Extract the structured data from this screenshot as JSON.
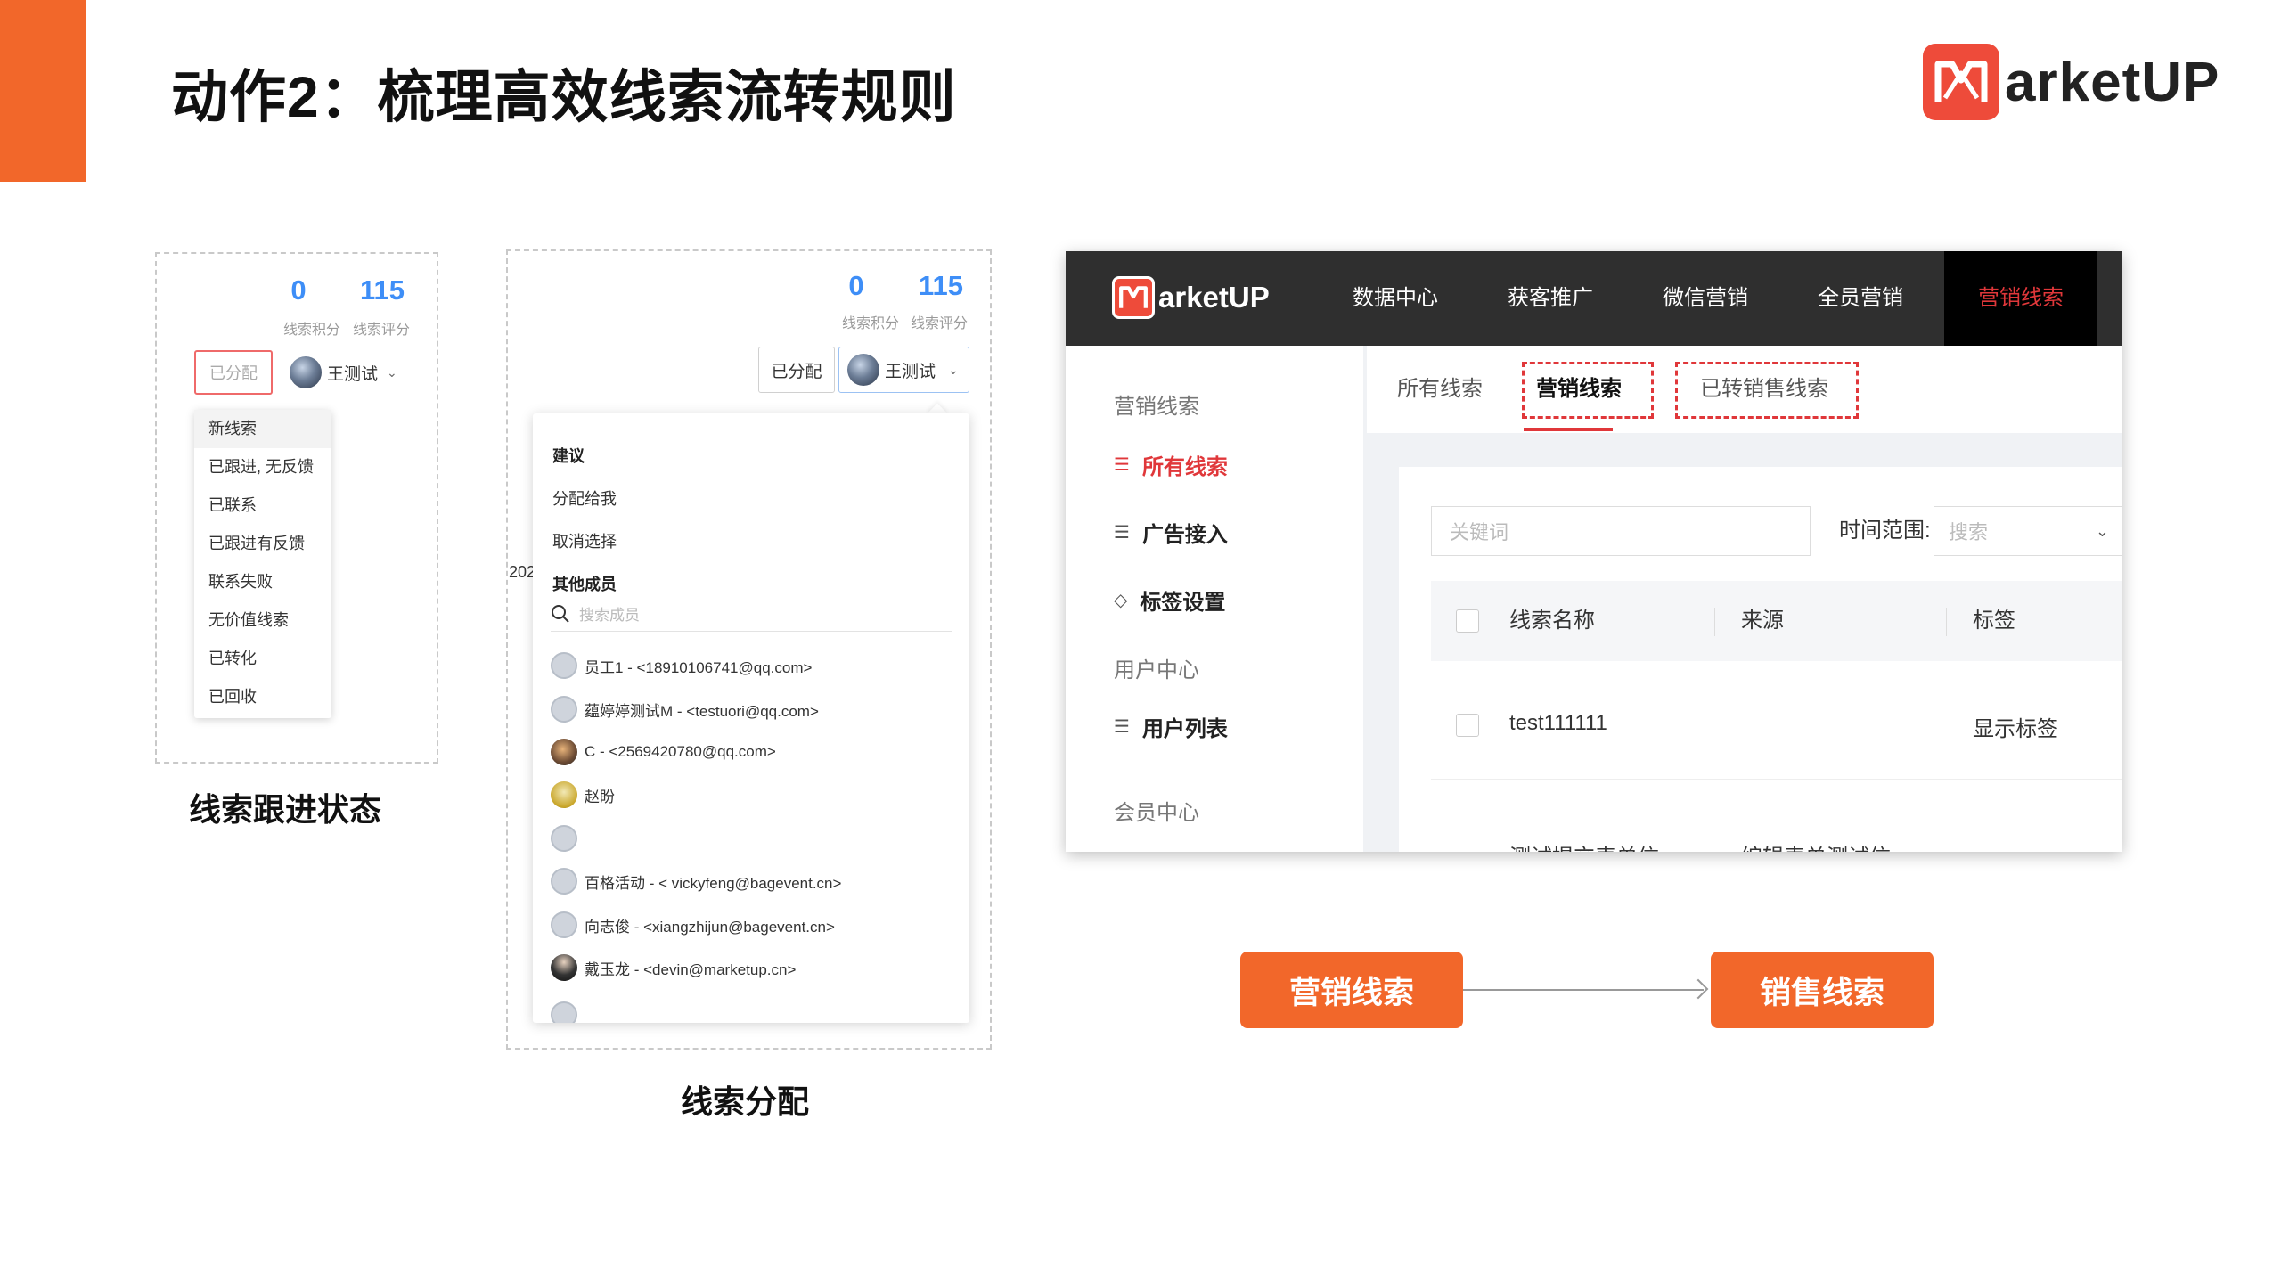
{
  "slide": {
    "title": "动作2：梳理高效线索流转规则",
    "brand_text": "arketUP",
    "accent_color": "#f2672a"
  },
  "panel_status": {
    "stats": [
      {
        "value": "0",
        "label": "线索积分"
      },
      {
        "value": "115",
        "label": "线索评分"
      }
    ],
    "assigned_button": "已分配",
    "user_name": "王测试",
    "status_menu": [
      "新线索",
      "已跟进, 无反馈",
      "已联系",
      "已跟进有反馈",
      "联系失败",
      "无价值线索",
      "已转化",
      "已回收"
    ],
    "caption": "线索跟进状态"
  },
  "panel_assign": {
    "stats": [
      {
        "value": "0",
        "label": "线索积分"
      },
      {
        "value": "115",
        "label": "线索评分"
      }
    ],
    "assigned_button": "已分配",
    "user_name": "王测试",
    "side_peek": "202",
    "suggest_header": "建议",
    "suggest_items": [
      "分配给我",
      "取消选择"
    ],
    "others_header": "其他成员",
    "search_placeholder": "搜索成员",
    "members": [
      {
        "text": "员工1 - <18910106741@qq.com>",
        "avatar": "default"
      },
      {
        "text": "蕴婷婷测试M - <testuori@qq.com>",
        "avatar": "default"
      },
      {
        "text": "C - <2569420780@qq.com>",
        "avatar": "photo1"
      },
      {
        "text": "赵盼",
        "avatar": "photo2"
      },
      {
        "text": "",
        "avatar": "default"
      },
      {
        "text": "百格活动 - < vickyfeng@bagevent.cn>",
        "avatar": "default"
      },
      {
        "text": "向志俊 - <xiangzhijun@bagevent.cn>",
        "avatar": "default"
      },
      {
        "text": "戴玉龙 - <devin@marketup.cn>",
        "avatar": "photo3"
      }
    ],
    "caption": "线索分配"
  },
  "app": {
    "logo_text": "arketUP",
    "nav": [
      "数据中心",
      "获客推广",
      "微信营销",
      "全员营销"
    ],
    "nav_active": "营销线索",
    "sidebar": {
      "group1": "营销线索",
      "items1": [
        "所有线索",
        "广告接入",
        "标签设置"
      ],
      "group2": "用户中心",
      "items2": [
        "用户列表"
      ],
      "group3": "会员中心"
    },
    "tabs": [
      "所有线索",
      "营销线索",
      "已转销售线索"
    ],
    "active_tab": "营销线索",
    "keyword_placeholder": "关键词",
    "time_range_label": "时间范围:",
    "select_placeholder": "搜索",
    "columns": [
      "线索名称",
      "来源",
      "标签"
    ],
    "rows": [
      {
        "name": "test111111",
        "source": "",
        "tag": "显示标签"
      }
    ],
    "partial_row": [
      "测试提交表单信",
      "编辑表单测试信"
    ],
    "accent_color": "#e0373a"
  },
  "flow": {
    "from": "营销线索",
    "to": "销售线索"
  }
}
